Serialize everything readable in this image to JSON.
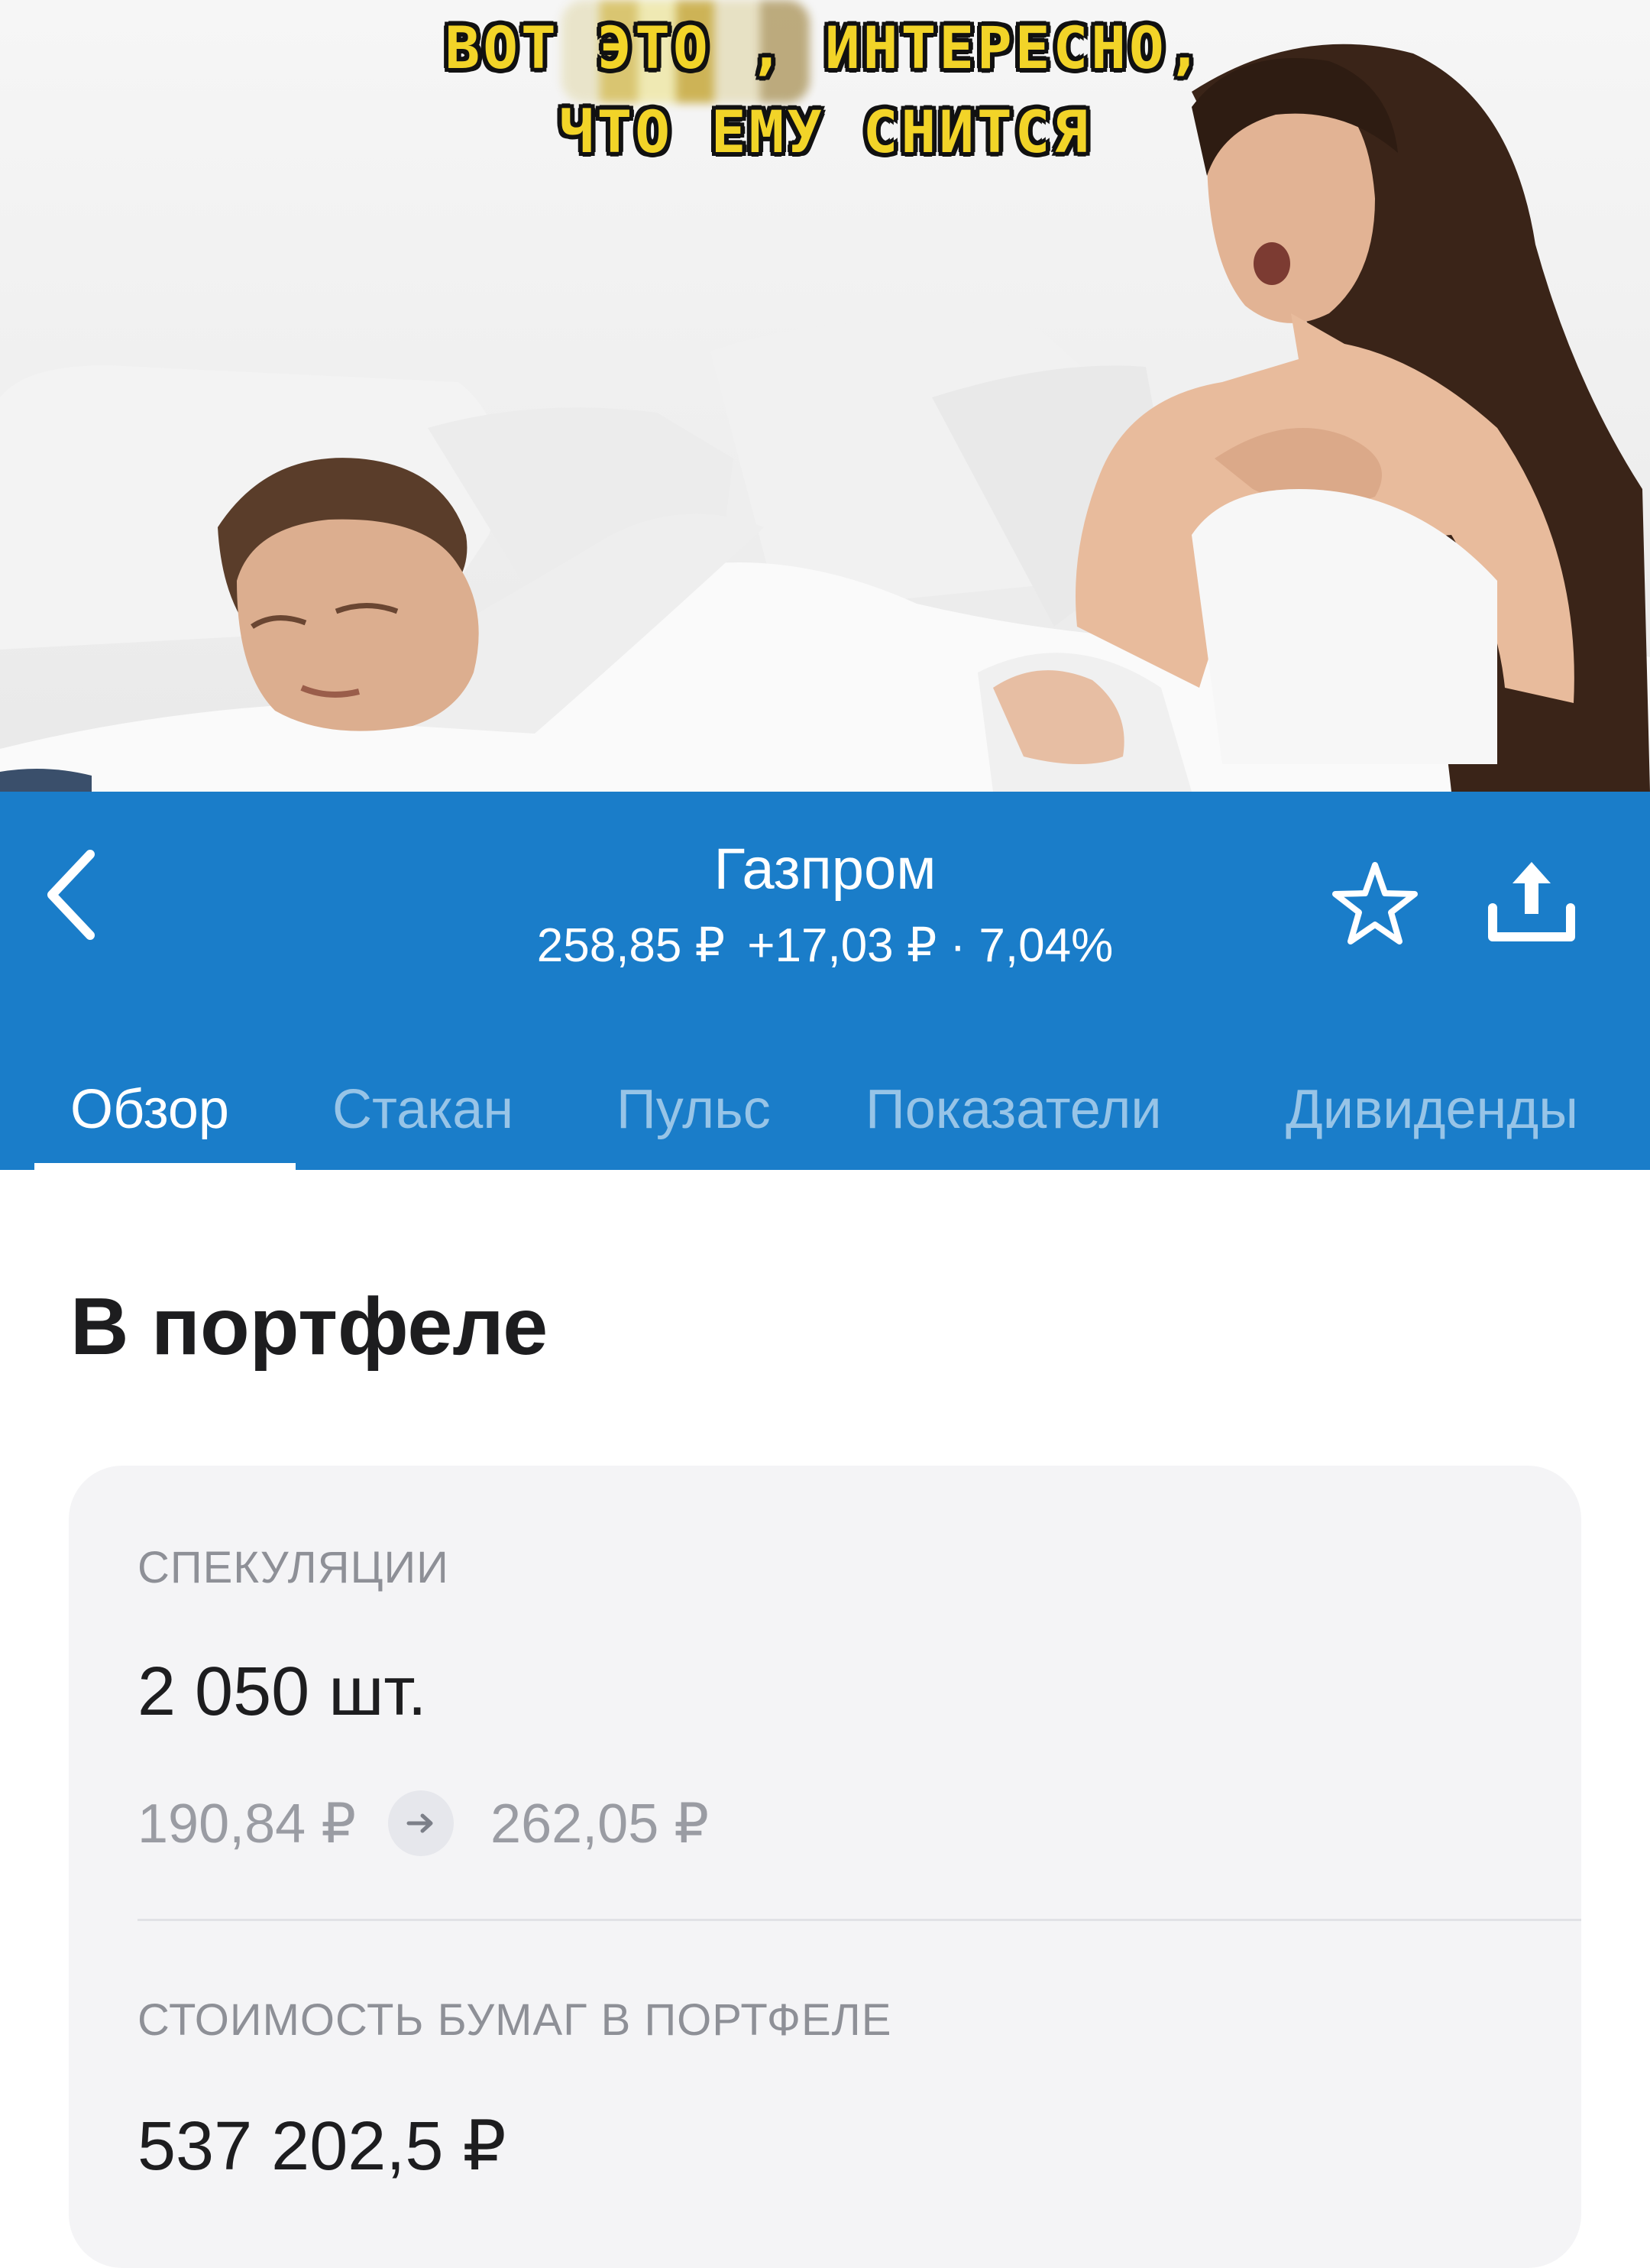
{
  "meme": {
    "caption_line1": "ВОТ ЭТО          , ИНТЕРЕСНО,",
    "caption_line2": "ЧТО ЕМУ СНИТСЯ"
  },
  "header": {
    "title": "Газпром",
    "price": "258,85 ₽",
    "change": "+17,03 ₽ · 7,04%",
    "background": "#1a7dc9"
  },
  "tabs": [
    {
      "label": "Обзор",
      "active": true
    },
    {
      "label": "Стакан",
      "active": false
    },
    {
      "label": "Пульс",
      "active": false
    },
    {
      "label": "Показатели",
      "active": false
    },
    {
      "label": "Дивиденды",
      "active": false
    }
  ],
  "portfolio": {
    "title": "В портфеле",
    "speculation_label": "СПЕКУЛЯЦИИ",
    "quantity": "2 050 шт.",
    "price_from": "190,84 ₽",
    "price_to": "262,05 ₽",
    "value_label": "СТОИМОСТЬ БУМАГ В ПОРТФЕЛЕ",
    "value": "537 202,5 ₽"
  },
  "icons": {
    "back": "chevron-left-icon",
    "favorite": "star-outline-icon",
    "share": "share-upload-icon",
    "arrow": "arrow-right-icon"
  }
}
